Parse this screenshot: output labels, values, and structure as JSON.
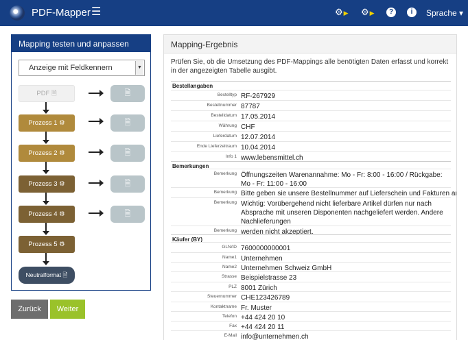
{
  "navbar": {
    "title": "PDF-Mapper",
    "lang_label": "Sprache ▾",
    "icons": [
      "gears-play-icon",
      "gears-play-icon",
      "help-icon",
      "info-icon"
    ]
  },
  "left": {
    "title": "Mapping testen und anpassen",
    "select_value": "Anzeige mit Feldkennern",
    "steps": {
      "pdf": "PDF",
      "p1": "Prozess 1",
      "p2": "Prozess 2",
      "p3": "Prozess 3",
      "p4": "Prozess 4",
      "p5": "Prozess 5",
      "neutral": "Neutralformat"
    },
    "back_label": "Zurück",
    "next_label": "Weiter"
  },
  "right": {
    "title": "Mapping-Ergebnis",
    "intro": "Prüfen Sie, ob die Umsetzung des PDF-Mappings alle benötigten Daten erfasst und korrekt in der angezeigten Tabelle ausgibt.",
    "sections": [
      {
        "name": "Bestellangaben",
        "rows": [
          {
            "k": "Bestelltyp",
            "v": "RF-267929"
          },
          {
            "k": "Bestellnummer",
            "v": "87787"
          },
          {
            "k": "Bestelldatum",
            "v": "17.05.2014"
          },
          {
            "k": "Währung",
            "v": "CHF"
          },
          {
            "k": "Lieferdatum",
            "v": "12.07.2014"
          },
          {
            "k": "Ende Lieferzeitraum",
            "v": "10.04.2014"
          },
          {
            "k": "Info 1",
            "v": "www.lebensmittel.ch"
          }
        ]
      },
      {
        "name": "Bemerkungen",
        "rows": [
          {
            "k": "Bemerkung",
            "v": "Öffnungszeiten Warenannahme: Mo - Fr: 8:00 - 16:00 / Rückgabe: Mo - Fr: 11:00 - 16:00"
          },
          {
            "k": "Bemerkung",
            "v": "Bitte geben sie unsere Bestellnummer auf Lieferschein und Fakturen an!"
          },
          {
            "k": "Bemerkung",
            "v": "Wichtig: Vorübergehend nicht lieferbare Artikel dürfen nur nach Absprache mit unseren Disponenten nachgeliefert werden. Andere Nachlieferungen"
          },
          {
            "k": "Bemerkung",
            "v": "werden nicht akzeptiert."
          }
        ]
      },
      {
        "name": "Käufer (BY)",
        "rows": [
          {
            "k": "GLN/ID",
            "v": "7600000000001"
          },
          {
            "k": "Name1",
            "v": "Unternehmen"
          },
          {
            "k": "Name2",
            "v": "Unternehmen Schweiz GmbH"
          },
          {
            "k": "Strasse",
            "v": "Beispielstrasse 23"
          },
          {
            "k": "PLZ",
            "v": "8001 Zürich"
          },
          {
            "k": "Steuernummer",
            "v": "CHE123426789"
          },
          {
            "k": "Kontaktname",
            "v": "Fr. Muster"
          },
          {
            "k": "Telefon",
            "v": "+44 424 20 10"
          },
          {
            "k": "Fax",
            "v": "+44 424 20 11"
          },
          {
            "k": "E-Mail",
            "v": "info@unternehmen.ch"
          }
        ]
      }
    ]
  }
}
